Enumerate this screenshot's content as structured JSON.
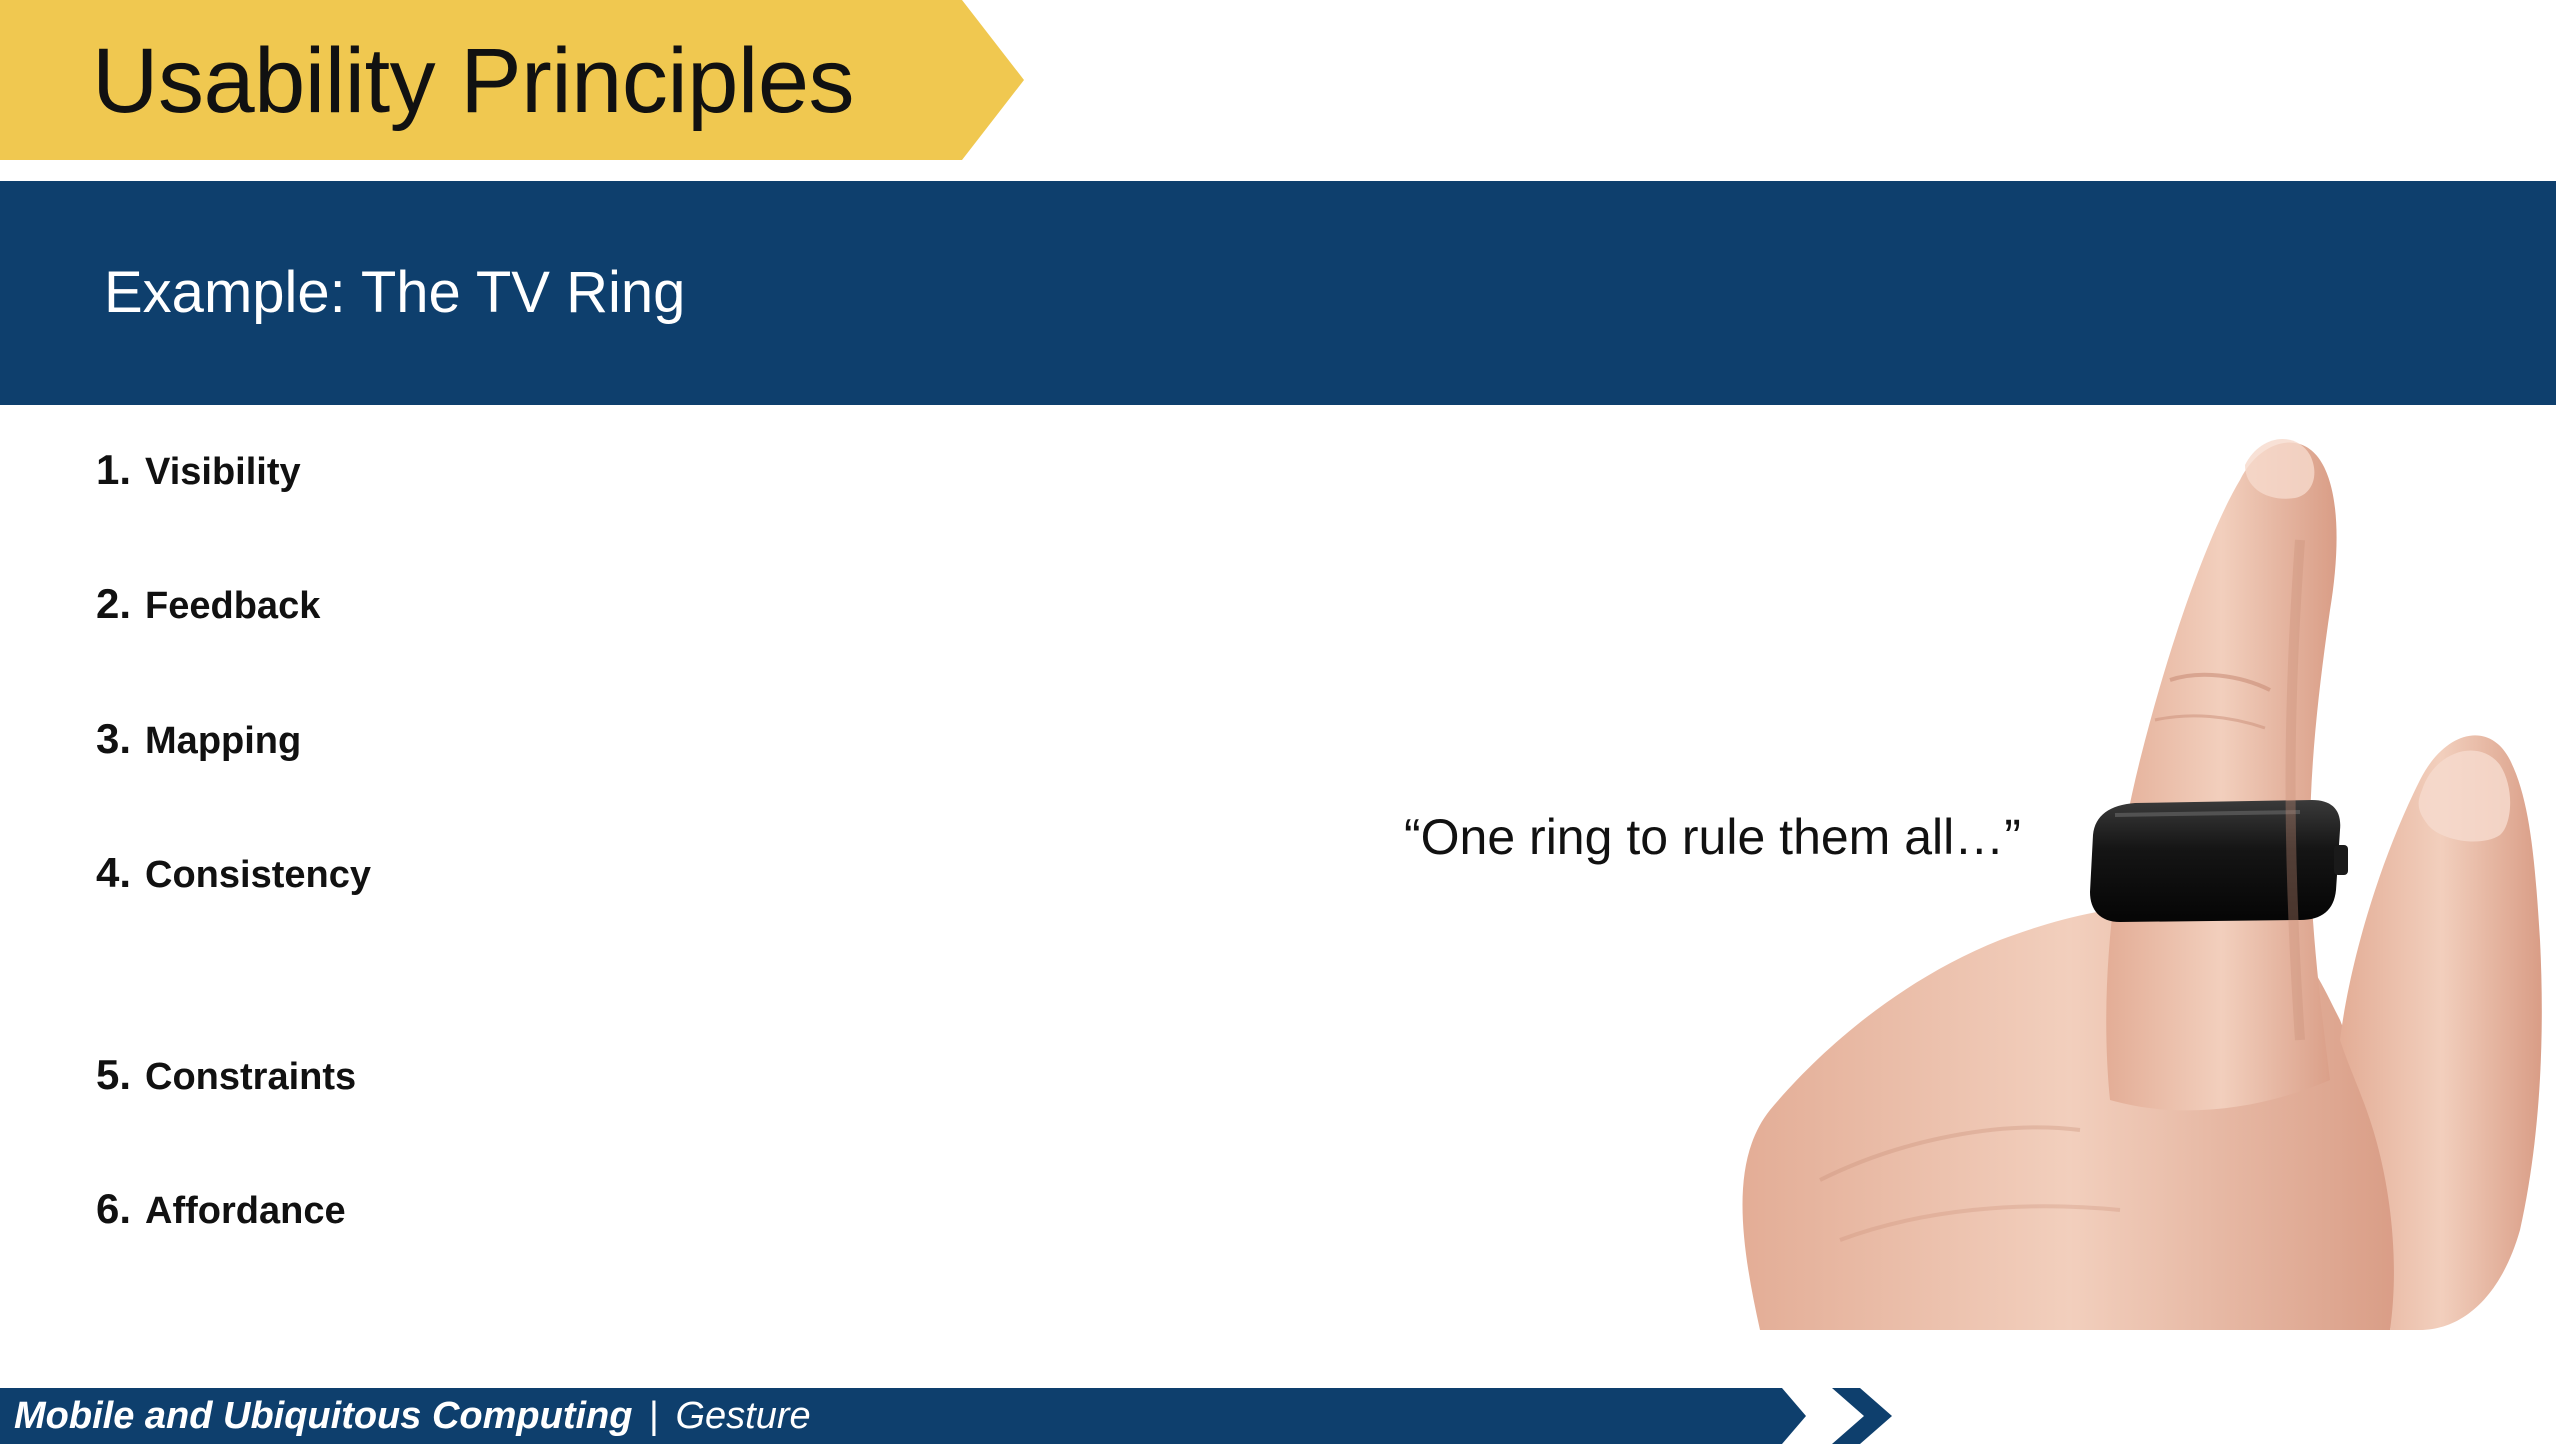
{
  "header": {
    "title": "Usability Principles",
    "subtitle": "Example: The TV Ring"
  },
  "principles": [
    {
      "number": "1.",
      "label": "Visibility"
    },
    {
      "number": "2.",
      "label": "Feedback"
    },
    {
      "number": "3.",
      "label": "Mapping"
    },
    {
      "number": "4.",
      "label": "Consistency"
    },
    {
      "number": "5.",
      "label": "Constraints"
    },
    {
      "number": "6.",
      "label": "Affordance"
    }
  ],
  "quote": "“One ring to rule them all…”",
  "footer": {
    "course": "Mobile and Ubiquitous Computing",
    "separator": "|",
    "topic": "Gesture"
  },
  "colors": {
    "title_banner": "#f0c850",
    "header_bar": "#0e3f6d",
    "footer_bar": "#0e3f6d"
  },
  "icons": {
    "footer_arrow": "chevron-right-icon"
  }
}
